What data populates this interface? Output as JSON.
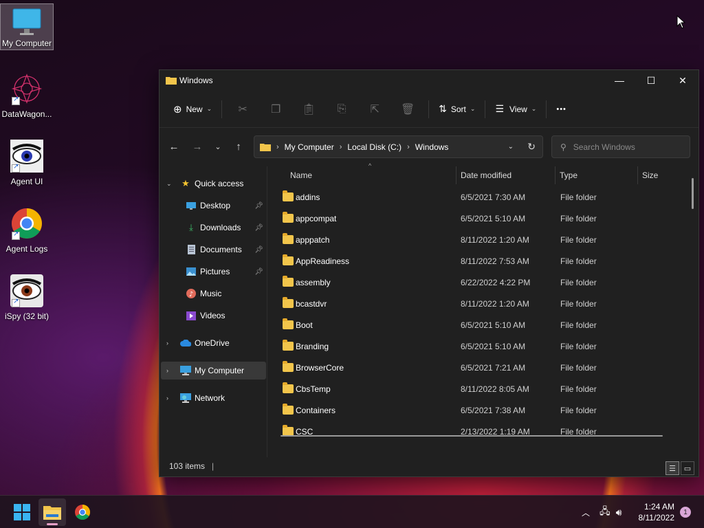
{
  "desktop": {
    "icons": [
      {
        "label": "My Computer",
        "icon": "monitor-icon",
        "selected": true,
        "shortcut": false
      },
      {
        "label": "DataWagon...",
        "icon": "datawagon-icon",
        "selected": false,
        "shortcut": true
      },
      {
        "label": "Agent UI",
        "icon": "eye-icon",
        "selected": false,
        "shortcut": true
      },
      {
        "label": "Agent Logs",
        "icon": "chrome-icon",
        "selected": false,
        "shortcut": true
      },
      {
        "label": "iSpy (32 bit)",
        "icon": "ispy-icon",
        "selected": false,
        "shortcut": true
      }
    ]
  },
  "window": {
    "title": "Windows",
    "controls": {
      "minimize": "—",
      "maximize": "☐",
      "close": "✕"
    }
  },
  "toolbar": {
    "new_label": "New",
    "sort_label": "Sort",
    "view_label": "View",
    "more_label": "•••",
    "disabled_icons": [
      "cut-icon",
      "copy-icon",
      "paste-icon",
      "rename-icon",
      "share-icon",
      "delete-icon"
    ]
  },
  "navigation": {
    "breadcrumb": [
      "My Computer",
      "Local Disk (C:)",
      "Windows"
    ],
    "search_placeholder": "Search Windows"
  },
  "sidebar": {
    "items": [
      {
        "label": "Quick access",
        "icon": "star-icon",
        "expanded": true,
        "pinned": false
      },
      {
        "label": "Desktop",
        "icon": "desktop-icon",
        "pinned": true
      },
      {
        "label": "Downloads",
        "icon": "download-icon",
        "pinned": true
      },
      {
        "label": "Documents",
        "icon": "document-icon",
        "pinned": true
      },
      {
        "label": "Pictures",
        "icon": "pictures-icon",
        "pinned": true
      },
      {
        "label": "Music",
        "icon": "music-icon",
        "pinned": false
      },
      {
        "label": "Videos",
        "icon": "videos-icon",
        "pinned": false
      },
      {
        "label": "OneDrive",
        "icon": "cloud-icon",
        "expanded": false
      },
      {
        "label": "My Computer",
        "icon": "computer-icon",
        "expanded": false,
        "selected": true
      },
      {
        "label": "Network",
        "icon": "network-icon",
        "expanded": false
      }
    ]
  },
  "file_list": {
    "columns": [
      "Name",
      "Date modified",
      "Type",
      "Size"
    ],
    "rows": [
      {
        "name": "addins",
        "date": "6/5/2021 7:30 AM",
        "type": "File folder"
      },
      {
        "name": "appcompat",
        "date": "6/5/2021 5:10 AM",
        "type": "File folder"
      },
      {
        "name": "apppatch",
        "date": "8/11/2022 1:20 AM",
        "type": "File folder"
      },
      {
        "name": "AppReadiness",
        "date": "8/11/2022 7:53 AM",
        "type": "File folder"
      },
      {
        "name": "assembly",
        "date": "6/22/2022 4:22 PM",
        "type": "File folder"
      },
      {
        "name": "bcastdvr",
        "date": "8/11/2022 1:20 AM",
        "type": "File folder"
      },
      {
        "name": "Boot",
        "date": "6/5/2021 5:10 AM",
        "type": "File folder"
      },
      {
        "name": "Branding",
        "date": "6/5/2021 5:10 AM",
        "type": "File folder"
      },
      {
        "name": "BrowserCore",
        "date": "6/5/2021 7:21 AM",
        "type": "File folder"
      },
      {
        "name": "CbsTemp",
        "date": "8/11/2022 8:05 AM",
        "type": "File folder"
      },
      {
        "name": "Containers",
        "date": "6/5/2021 7:38 AM",
        "type": "File folder"
      },
      {
        "name": "CSC",
        "date": "2/13/2022 1:19 AM",
        "type": "File folder"
      }
    ]
  },
  "status": {
    "item_count": "103 items"
  },
  "taskbar": {
    "apps": [
      "start-icon",
      "file-explorer-icon",
      "chrome-icon"
    ],
    "clock_time": "1:24 AM",
    "clock_date": "8/11/2022",
    "notification_count": "1"
  },
  "colors": {
    "window_bg": "#202020",
    "folder": "#f2c54b",
    "accent": "#0078d4"
  }
}
